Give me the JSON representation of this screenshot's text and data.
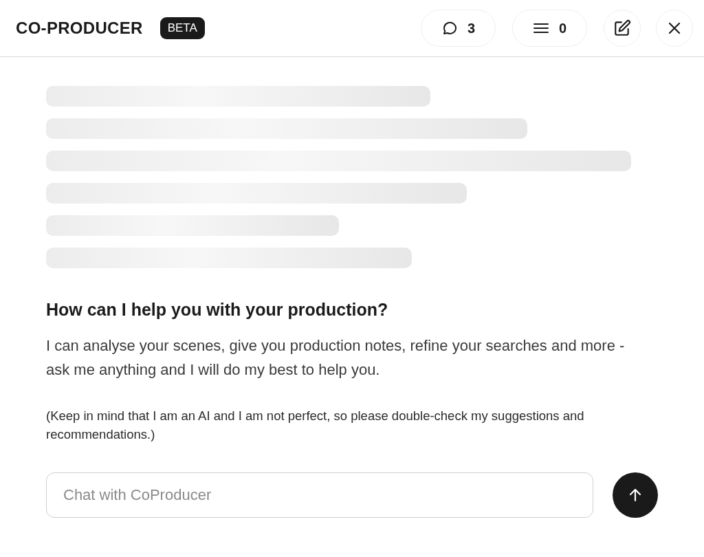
{
  "header": {
    "title": "CO-PRODUCER",
    "badge": "BETA",
    "buttons": [
      {
        "kind": "comments",
        "label": "3"
      },
      {
        "kind": "list",
        "label": "0"
      },
      {
        "kind": "edit"
      },
      {
        "kind": "close"
      }
    ]
  },
  "content": {
    "loading": true,
    "heading": "How can I help you with your production?",
    "intro": "I can analyse your scenes, give you production notes, refine your searches and more - ask me anything and I will do my best to help you.",
    "note": "(Keep in mind that I am an AI and I am not perfect, so please double-check my suggestions and recommendations.)"
  },
  "chat": {
    "placeholder": "Chat with CoProducer"
  }
}
